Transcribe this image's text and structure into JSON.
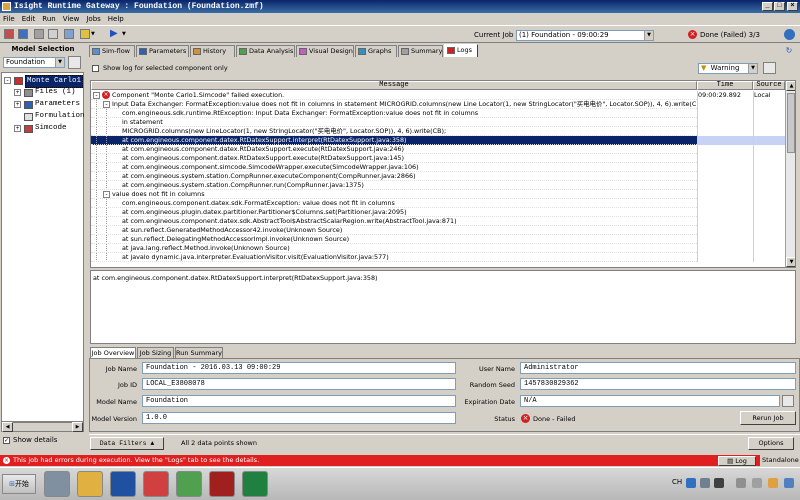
{
  "window": {
    "title": "Isight Runtime Gateway : Foundation (Foundation.zmf)",
    "controls": [
      "_",
      "□",
      "×"
    ]
  },
  "menu": [
    "File",
    "Edit",
    "Run",
    "View",
    "Jobs",
    "Help"
  ],
  "toolbar": {
    "current_job_label": "Current Job",
    "current_job_value": "(1) Foundation - 09:00:29",
    "status_text": "Done (Failed) 3/3",
    "status_color": "#d02020"
  },
  "model_selection": {
    "title": "Model Selection",
    "selected": "Foundation",
    "tree": [
      {
        "label": "Monte Carlo1",
        "sign": "-",
        "icon": "montecarlo-icon",
        "icon_color": "#c83030",
        "selected": true,
        "level": 0
      },
      {
        "label": "Files (1)",
        "sign": "+",
        "icon": "files-icon",
        "icon_color": "#909090",
        "selected": false,
        "level": 1
      },
      {
        "label": "Parameters",
        "sign": "+",
        "icon": "parameters-icon",
        "icon_color": "#3060b0",
        "selected": false,
        "level": 1
      },
      {
        "label": "Formulation",
        "sign": "",
        "icon": "formulation-icon",
        "icon_color": "#e0e0e0",
        "selected": false,
        "level": 1
      },
      {
        "label": "Simcode",
        "sign": "+",
        "icon": "simcode-icon",
        "icon_color": "#c04040",
        "selected": false,
        "level": 1
      }
    ],
    "show_details_label": "Show details",
    "show_details_checked": true
  },
  "tabs": [
    {
      "label": "Sim-flow",
      "icon_color": "#5a8fd0"
    },
    {
      "label": "Parameters",
      "icon_color": "#3060b0"
    },
    {
      "label": "History",
      "icon_color": "#d09040"
    },
    {
      "label": "Data Analysis",
      "icon_color": "#50a050"
    },
    {
      "label": "Visual Design",
      "icon_color": "#c060c0"
    },
    {
      "label": "Graphs",
      "icon_color": "#3090c0"
    },
    {
      "label": "Summary",
      "icon_color": "#a0a0a0"
    },
    {
      "label": "Logs",
      "icon_color": "#d02020",
      "active": true
    }
  ],
  "logs": {
    "show_log_label": "Show log for selected component only",
    "level_filter": "Warning",
    "columns": [
      "Message",
      "Time",
      "Source"
    ],
    "rows": [
      {
        "indent": 0,
        "sign": "-",
        "error": true,
        "text": "Component \"Monte Carlo1.Simcode\" failed execution.",
        "time": "09:00:29.892",
        "source": "Local"
      },
      {
        "indent": 1,
        "sign": "-",
        "text": "Input Data Exchanger: FormatException:value does not fit in columns in statement    MICROGRID.columns(new Line Locator(1, new StringLocator(\"买电电价\", Locator.SOP)), 4, 6).write(CB);",
        "time": "",
        "source": ""
      },
      {
        "indent": 2,
        "text": "com.engineous.sdk.runtime.RtException: Input Data Exchanger: FormatException:value does not fit in columns",
        "time": "",
        "source": ""
      },
      {
        "indent": 2,
        "text": "in statement",
        "time": "",
        "source": ""
      },
      {
        "indent": 2,
        "text": "MICROGRID.columns(new LineLocator(1, new StringLocator(\"买电电价\", Locator.SOP)), 4, 6).write(CB);",
        "time": "",
        "source": ""
      },
      {
        "indent": 2,
        "text": "at com.engineous.component.datex.RtDatexSupport.interpret(RtDatexSupport.java:358)",
        "time": "",
        "source": "",
        "selected": true
      },
      {
        "indent": 2,
        "text": "at com.engineous.component.datex.RtDatexSupport.execute(RtDatexSupport.java:246)",
        "time": "",
        "source": ""
      },
      {
        "indent": 2,
        "text": "at com.engineous.component.datex.RtDatexSupport.execute(RtDatexSupport.java:145)",
        "time": "",
        "source": ""
      },
      {
        "indent": 2,
        "text": "at com.engineous.component.simcode.SimcodeWrapper.execute(SimcodeWrapper.java:106)",
        "time": "",
        "source": ""
      },
      {
        "indent": 2,
        "text": "at com.engineous.system.station.CompRunner.executeComponent(CompRunner.java:2866)",
        "time": "",
        "source": ""
      },
      {
        "indent": 2,
        "text": "at com.engineous.system.station.CompRunner.run(CompRunner.java:1375)",
        "time": "",
        "source": ""
      },
      {
        "indent": 1,
        "sign": "-",
        "text": "value does not fit in columns",
        "time": "",
        "source": ""
      },
      {
        "indent": 2,
        "text": "com.engineous.component.datex.sdk.FormatException: value does not fit in columns",
        "time": "",
        "source": ""
      },
      {
        "indent": 2,
        "text": "at com.engineous.plugin.datex.partitioner.Partitioner$Columns.set(Partitioner.java:2095)",
        "time": "",
        "source": ""
      },
      {
        "indent": 2,
        "text": "at com.engineous.component.datex.sdk.AbstractTool$AbstractScalarRegion.write(AbstractTool.java:871)",
        "time": "",
        "source": ""
      },
      {
        "indent": 2,
        "text": "at sun.reflect.GeneratedMethodAccessor42.invoke(Unknown Source)",
        "time": "",
        "source": ""
      },
      {
        "indent": 2,
        "text": "at sun.reflect.DelegatingMethodAccessorImpl.invoke(Unknown Source)",
        "time": "",
        "source": ""
      },
      {
        "indent": 2,
        "text": "at java.lang.reflect.Method.invoke(Unknown Source)",
        "time": "",
        "source": ""
      },
      {
        "indent": 2,
        "text": "at javalo dynamic.java.interpreter.EvaluationVisitor.visit(EvaluationVisitor.java:577)",
        "time": "",
        "source": ""
      }
    ],
    "detail_text": "at com.engineous.component.datex.RtDatexSupport.interpret(RtDatexSupport.java:358)"
  },
  "bottom_tabs": [
    {
      "label": "Job Overview",
      "active": true
    },
    {
      "label": "Job Sizing"
    },
    {
      "label": "Run Summary"
    }
  ],
  "job_overview": {
    "job_name_label": "Job Name",
    "job_name": "Foundation - 2016.03.13 09:00:29",
    "job_id_label": "Job ID",
    "job_id": "LOCAL_E3808078",
    "model_name_label": "Model Name",
    "model_name": "Foundation",
    "model_version_label": "Model Version",
    "model_version": "1.0.0",
    "user_name_label": "User Name",
    "user_name": "Administrator",
    "random_seed_label": "Random Seed",
    "random_seed": "1457830829362",
    "expiration_label": "Expiration Date",
    "expiration": "N/A",
    "status_label": "Status",
    "status": "Done - Failed",
    "rerun_label": "Rerun Job"
  },
  "data_filters": {
    "label": "Data Filters",
    "shown_text": "All 2 data points shown",
    "options_label": "Options"
  },
  "status_bar": {
    "message": "This job had errors during execution. View the \"Logs\" tab to see the details.",
    "log_button": "Log",
    "mode": "Standalone"
  },
  "taskbar": {
    "start_label": "开始",
    "apps": [
      {
        "name": "computer-app",
        "color": "#8090a0"
      },
      {
        "name": "explorer-app",
        "color": "#e0b040"
      },
      {
        "name": "word-app",
        "color": "#2050a0"
      },
      {
        "name": "chrome-app",
        "color": "#d04040"
      },
      {
        "name": "isight-app",
        "color": "#50a050"
      },
      {
        "name": "lingo-app",
        "color": "#a02020"
      },
      {
        "name": "excel-app",
        "color": "#208040"
      }
    ],
    "lang": "CH"
  }
}
